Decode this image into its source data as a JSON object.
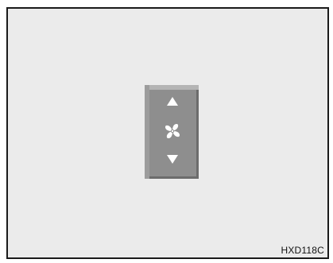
{
  "figure": {
    "code": "HXD118C"
  },
  "switch": {
    "up_icon": "triangle-up-icon",
    "center_icon": "fan-icon",
    "down_icon": "triangle-down-icon"
  },
  "colors": {
    "background": "#ebebeb",
    "switch": "#8e8e8e",
    "glyph": "#ffffff",
    "border": "#1a1a1a"
  }
}
